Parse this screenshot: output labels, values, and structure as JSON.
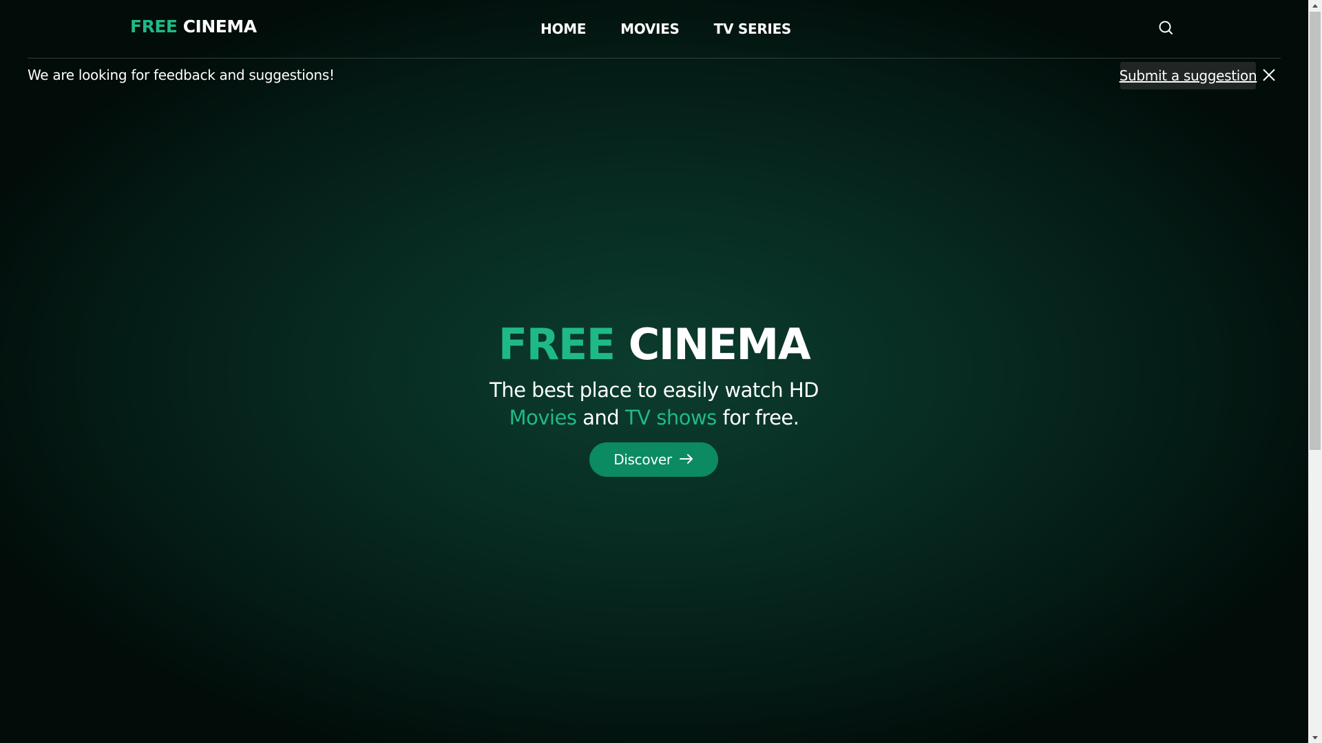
{
  "header": {
    "logo": {
      "free": "FREE",
      "cinema": "CINEMA"
    },
    "nav": [
      {
        "label": "HOME"
      },
      {
        "label": "MOVIES"
      },
      {
        "label": "TV SERIES"
      }
    ],
    "search_icon": "search-icon"
  },
  "banner": {
    "message": "We are looking for feedback and suggestions!",
    "suggest_label": "Submit a suggestion",
    "close_icon": "close-icon"
  },
  "hero": {
    "title_free": "FREE",
    "title_cinema": "CINEMA",
    "line1": "The best place to easily watch HD",
    "movies": "Movies",
    "and": "and",
    "tv_shows": "TV shows",
    "for_free": "for free.",
    "discover_label": "Discover",
    "discover_icon": "arrow-right-icon"
  },
  "colors": {
    "accent": "#1fb987",
    "button": "#0c8a62",
    "background": "#041b15"
  }
}
